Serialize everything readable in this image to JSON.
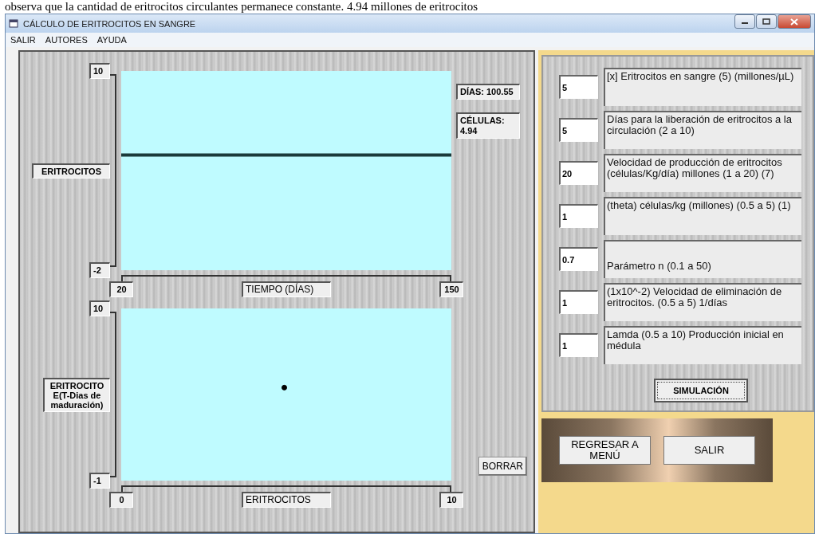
{
  "caption_fragment": "observa que la cantidad de eritrocitos circulantes permanece constante. 4.94 millones de eritrocitos",
  "window": {
    "title": "CÁLCULO DE ERITROCITOS EN SANGRE"
  },
  "menu": [
    "SALIR",
    "AUTORES",
    "AYUDA"
  ],
  "time_chart": {
    "y_label": "ERITROCITOS",
    "x_label": "TIEMPO (DÍAS)",
    "readouts": [
      "DÍAS: 100.55",
      "CÉLULAS: 4.94"
    ],
    "chart_data": {
      "type": "line",
      "x": [
        20,
        150
      ],
      "xlim": [
        20,
        150
      ],
      "ylim": [
        -2,
        10
      ],
      "xticks": [
        20,
        150
      ],
      "yticks": [
        -2,
        10
      ],
      "series": [
        {
          "color": "#1a3a3a",
          "values": [
            4.94,
            4.94
          ]
        }
      ]
    }
  },
  "phase_chart": {
    "y_label": "ERITROCITO E(T-Dias de maduración)",
    "x_label": "ERITROCITOS",
    "chart_data": {
      "type": "scatter",
      "x": [
        4.94
      ],
      "xlim": [
        0,
        10
      ],
      "ylim": [
        -1,
        10
      ],
      "xticks": [
        0,
        10
      ],
      "yticks": [
        -1,
        10
      ],
      "series": [
        {
          "color": "#000000",
          "values": [
            4.94
          ]
        }
      ]
    }
  },
  "clear_button": "BORRAR",
  "parameters": [
    {
      "value": "5",
      "label": "[x] Eritrocitos en sangre  (5) (millones/µL)",
      "kind": "top"
    },
    {
      "value": "5",
      "label": "Días para la liberación de eritrocitos a la circulación  (2 a 10)",
      "kind": "top"
    },
    {
      "value": "20",
      "label": "Velocidad de producción de eritrocitos (células/Kg/día) millones (1 a 20) (7)",
      "kind": "top"
    },
    {
      "value": "1",
      "label": "(theta) células/kg  (millones) (0.5 a 5) (1)",
      "kind": "top"
    },
    {
      "value": "0.7",
      "label": "Parámetro n  (0.1 a 50)",
      "kind": "bottom"
    },
    {
      "value": "1",
      "label": "(1x10^-2)  Velocidad de eliminación de eritrocitos. (0.5 a 5) 1/días",
      "kind": "top"
    },
    {
      "value": "1",
      "label": "Lamda (0.5 a 10)  Producción inicial en médula",
      "kind": "top"
    }
  ],
  "simulate_button": "SIMULACIÓN",
  "footer_buttons": [
    "REGRESAR A MENÚ",
    "SALIR"
  ]
}
